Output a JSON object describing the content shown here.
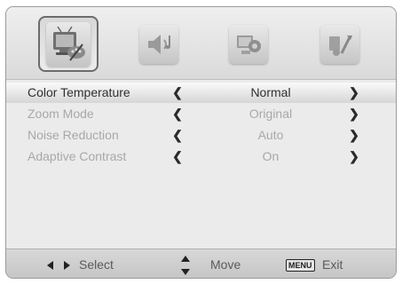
{
  "tabs": [
    {
      "name": "picture-tab",
      "icon": "picture-icon",
      "active": true
    },
    {
      "name": "sound-tab",
      "icon": "sound-icon",
      "active": false
    },
    {
      "name": "setup-tab",
      "icon": "setup-icon",
      "active": false
    },
    {
      "name": "tools-tab",
      "icon": "tools-icon",
      "active": false
    }
  ],
  "menu": {
    "items": [
      {
        "label": "Color Temperature",
        "value": "Normal"
      },
      {
        "label": "Zoom Mode",
        "value": "Original"
      },
      {
        "label": "Noise Reduction",
        "value": "Auto"
      },
      {
        "label": "Adaptive Contrast",
        "value": "On"
      }
    ],
    "left_arrow": "❮",
    "right_arrow": "❯"
  },
  "footer": {
    "select_label": "Select",
    "move_label": "Move",
    "menu_key": "MENU",
    "exit_label": "Exit"
  },
  "colors": {
    "selected_text": "#303030",
    "dim_text": "#a8a8a8",
    "panel": "#ebebeb"
  }
}
